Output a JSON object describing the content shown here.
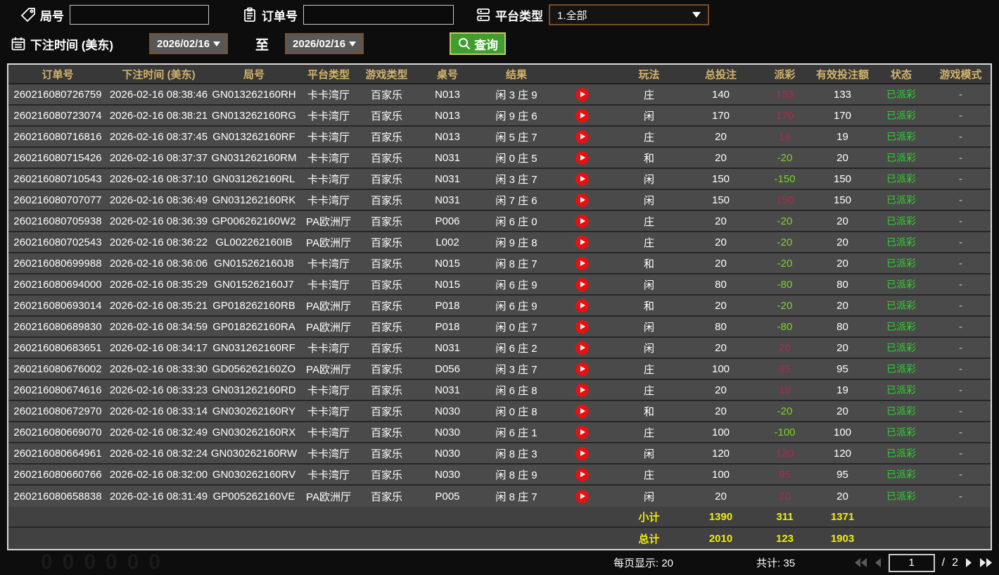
{
  "filters": {
    "round": {
      "label": "局号",
      "value": ""
    },
    "order": {
      "label": "订单号",
      "value": ""
    },
    "platform": {
      "label": "平台类型",
      "value": "1.全部"
    },
    "bet_time": {
      "label": "下注时间 (美东)",
      "from": "2026/02/16",
      "to": "2026/02/16",
      "to_word": "至"
    },
    "search": {
      "label": "查询"
    }
  },
  "table": {
    "columns": [
      "订单号",
      "下注时间 (美东)",
      "局号",
      "平台类型",
      "游戏类型",
      "桌号",
      "结果",
      "",
      "玩法",
      "总投注",
      "派彩",
      "有效投注额",
      "状态",
      "游戏模式"
    ],
    "rows": [
      {
        "order_no": "260216080726759",
        "bet_time": "2026-02-16 08:38:46",
        "round_no": "GN013262160RH",
        "platform": "卡卡湾厅",
        "game_type": "百家乐",
        "table_no": "N013",
        "result": "闲 3 庄 9",
        "bet_type": "庄",
        "total_bet": "140",
        "payout": "133",
        "payout_sign": "pos",
        "valid_bet": "133",
        "status": "已派彩",
        "game_mode": "-"
      },
      {
        "order_no": "260216080723074",
        "bet_time": "2026-02-16 08:38:21",
        "round_no": "GN013262160RG",
        "platform": "卡卡湾厅",
        "game_type": "百家乐",
        "table_no": "N013",
        "result": "闲 9 庄 6",
        "bet_type": "闲",
        "total_bet": "170",
        "payout": "170",
        "payout_sign": "pos",
        "valid_bet": "170",
        "status": "已派彩",
        "game_mode": "-"
      },
      {
        "order_no": "260216080716816",
        "bet_time": "2026-02-16 08:37:45",
        "round_no": "GN013262160RF",
        "platform": "卡卡湾厅",
        "game_type": "百家乐",
        "table_no": "N013",
        "result": "闲 5 庄 7",
        "bet_type": "庄",
        "total_bet": "20",
        "payout": "19",
        "payout_sign": "pos",
        "valid_bet": "19",
        "status": "已派彩",
        "game_mode": "-"
      },
      {
        "order_no": "260216080715426",
        "bet_time": "2026-02-16 08:37:37",
        "round_no": "GN031262160RM",
        "platform": "卡卡湾厅",
        "game_type": "百家乐",
        "table_no": "N031",
        "result": "闲 0 庄 5",
        "bet_type": "和",
        "total_bet": "20",
        "payout": "-20",
        "payout_sign": "neg",
        "valid_bet": "20",
        "status": "已派彩",
        "game_mode": "-"
      },
      {
        "order_no": "260216080710543",
        "bet_time": "2026-02-16 08:37:10",
        "round_no": "GN031262160RL",
        "platform": "卡卡湾厅",
        "game_type": "百家乐",
        "table_no": "N031",
        "result": "闲 3 庄 7",
        "bet_type": "闲",
        "total_bet": "150",
        "payout": "-150",
        "payout_sign": "neg",
        "valid_bet": "150",
        "status": "已派彩",
        "game_mode": "-"
      },
      {
        "order_no": "260216080707077",
        "bet_time": "2026-02-16 08:36:49",
        "round_no": "GN031262160RK",
        "platform": "卡卡湾厅",
        "game_type": "百家乐",
        "table_no": "N031",
        "result": "闲 7 庄 6",
        "bet_type": "闲",
        "total_bet": "150",
        "payout": "150",
        "payout_sign": "pos",
        "valid_bet": "150",
        "status": "已派彩",
        "game_mode": "-"
      },
      {
        "order_no": "260216080705938",
        "bet_time": "2026-02-16 08:36:39",
        "round_no": "GP006262160W2",
        "platform": "PA欧洲厅",
        "game_type": "百家乐",
        "table_no": "P006",
        "result": "闲 6 庄 0",
        "bet_type": "庄",
        "total_bet": "20",
        "payout": "-20",
        "payout_sign": "neg",
        "valid_bet": "20",
        "status": "已派彩",
        "game_mode": "-"
      },
      {
        "order_no": "260216080702543",
        "bet_time": "2026-02-16 08:36:22",
        "round_no": "GL002262160IB",
        "platform": "PA欧洲厅",
        "game_type": "百家乐",
        "table_no": "L002",
        "result": "闲 9 庄 8",
        "bet_type": "庄",
        "total_bet": "20",
        "payout": "-20",
        "payout_sign": "neg",
        "valid_bet": "20",
        "status": "已派彩",
        "game_mode": "-"
      },
      {
        "order_no": "260216080699988",
        "bet_time": "2026-02-16 08:36:06",
        "round_no": "GN015262160J8",
        "platform": "卡卡湾厅",
        "game_type": "百家乐",
        "table_no": "N015",
        "result": "闲 8 庄 7",
        "bet_type": "和",
        "total_bet": "20",
        "payout": "-20",
        "payout_sign": "neg",
        "valid_bet": "20",
        "status": "已派彩",
        "game_mode": "-"
      },
      {
        "order_no": "260216080694000",
        "bet_time": "2026-02-16 08:35:29",
        "round_no": "GN015262160J7",
        "platform": "卡卡湾厅",
        "game_type": "百家乐",
        "table_no": "N015",
        "result": "闲 6 庄 9",
        "bet_type": "闲",
        "total_bet": "80",
        "payout": "-80",
        "payout_sign": "neg",
        "valid_bet": "80",
        "status": "已派彩",
        "game_mode": "-"
      },
      {
        "order_no": "260216080693014",
        "bet_time": "2026-02-16 08:35:21",
        "round_no": "GP018262160RB",
        "platform": "PA欧洲厅",
        "game_type": "百家乐",
        "table_no": "P018",
        "result": "闲 6 庄 9",
        "bet_type": "和",
        "total_bet": "20",
        "payout": "-20",
        "payout_sign": "neg",
        "valid_bet": "20",
        "status": "已派彩",
        "game_mode": "-"
      },
      {
        "order_no": "260216080689830",
        "bet_time": "2026-02-16 08:34:59",
        "round_no": "GP018262160RA",
        "platform": "PA欧洲厅",
        "game_type": "百家乐",
        "table_no": "P018",
        "result": "闲 0 庄 7",
        "bet_type": "闲",
        "total_bet": "80",
        "payout": "-80",
        "payout_sign": "neg",
        "valid_bet": "80",
        "status": "已派彩",
        "game_mode": "-"
      },
      {
        "order_no": "260216080683651",
        "bet_time": "2026-02-16 08:34:17",
        "round_no": "GN031262160RF",
        "platform": "卡卡湾厅",
        "game_type": "百家乐",
        "table_no": "N031",
        "result": "闲 6 庄 2",
        "bet_type": "闲",
        "total_bet": "20",
        "payout": "20",
        "payout_sign": "pos",
        "valid_bet": "20",
        "status": "已派彩",
        "game_mode": "-"
      },
      {
        "order_no": "260216080676002",
        "bet_time": "2026-02-16 08:33:30",
        "round_no": "GD056262160ZO",
        "platform": "PA欧洲厅",
        "game_type": "百家乐",
        "table_no": "D056",
        "result": "闲 3 庄 7",
        "bet_type": "庄",
        "total_bet": "100",
        "payout": "95",
        "payout_sign": "pos",
        "valid_bet": "95",
        "status": "已派彩",
        "game_mode": "-"
      },
      {
        "order_no": "260216080674616",
        "bet_time": "2026-02-16 08:33:23",
        "round_no": "GN031262160RD",
        "platform": "卡卡湾厅",
        "game_type": "百家乐",
        "table_no": "N031",
        "result": "闲 6 庄 8",
        "bet_type": "庄",
        "total_bet": "20",
        "payout": "19",
        "payout_sign": "pos",
        "valid_bet": "19",
        "status": "已派彩",
        "game_mode": "-"
      },
      {
        "order_no": "260216080672970",
        "bet_time": "2026-02-16 08:33:14",
        "round_no": "GN030262160RY",
        "platform": "卡卡湾厅",
        "game_type": "百家乐",
        "table_no": "N030",
        "result": "闲 0 庄 8",
        "bet_type": "和",
        "total_bet": "20",
        "payout": "-20",
        "payout_sign": "neg",
        "valid_bet": "20",
        "status": "已派彩",
        "game_mode": "-"
      },
      {
        "order_no": "260216080669070",
        "bet_time": "2026-02-16 08:32:49",
        "round_no": "GN030262160RX",
        "platform": "卡卡湾厅",
        "game_type": "百家乐",
        "table_no": "N030",
        "result": "闲 6 庄 1",
        "bet_type": "庄",
        "total_bet": "100",
        "payout": "-100",
        "payout_sign": "neg",
        "valid_bet": "100",
        "status": "已派彩",
        "game_mode": "-"
      },
      {
        "order_no": "260216080664961",
        "bet_time": "2026-02-16 08:32:24",
        "round_no": "GN030262160RW",
        "platform": "卡卡湾厅",
        "game_type": "百家乐",
        "table_no": "N030",
        "result": "闲 8 庄 3",
        "bet_type": "闲",
        "total_bet": "120",
        "payout": "120",
        "payout_sign": "pos",
        "valid_bet": "120",
        "status": "已派彩",
        "game_mode": "-"
      },
      {
        "order_no": "260216080660766",
        "bet_time": "2026-02-16 08:32:00",
        "round_no": "GN030262160RV",
        "platform": "卡卡湾厅",
        "game_type": "百家乐",
        "table_no": "N030",
        "result": "闲 8 庄 9",
        "bet_type": "庄",
        "total_bet": "100",
        "payout": "95",
        "payout_sign": "pos",
        "valid_bet": "95",
        "status": "已派彩",
        "game_mode": "-"
      },
      {
        "order_no": "260216080658838",
        "bet_time": "2026-02-16 08:31:49",
        "round_no": "GP005262160VE",
        "platform": "PA欧洲厅",
        "game_type": "百家乐",
        "table_no": "P005",
        "result": "闲 8 庄 7",
        "bet_type": "闲",
        "total_bet": "20",
        "payout": "20",
        "payout_sign": "pos",
        "valid_bet": "20",
        "status": "已派彩",
        "game_mode": "-"
      }
    ],
    "subtotal": {
      "label": "小计",
      "total_bet": "1390",
      "payout": "311",
      "valid_bet": "1371"
    },
    "grand_total": {
      "label": "总计",
      "total_bet": "2010",
      "payout": "123",
      "valid_bet": "1903"
    }
  },
  "footer": {
    "per_page_label": "每页显示:",
    "per_page_value": "20",
    "total_count_label": "共计:",
    "total_count_value": "35",
    "pagination": {
      "current_page": "1",
      "separator": "/",
      "total_pages": "2"
    }
  },
  "colors": {
    "header_text_gold": "#d4b46a",
    "payout_win_red": "#ad2a4a",
    "payout_loss_green": "#79d621",
    "status_paid_green": "#2fd32f",
    "totals_yellow": "#f0ec10",
    "search_button_green": "#3f9e2f",
    "picker_border_brown": "#7a4f28"
  },
  "watermark": "000000"
}
